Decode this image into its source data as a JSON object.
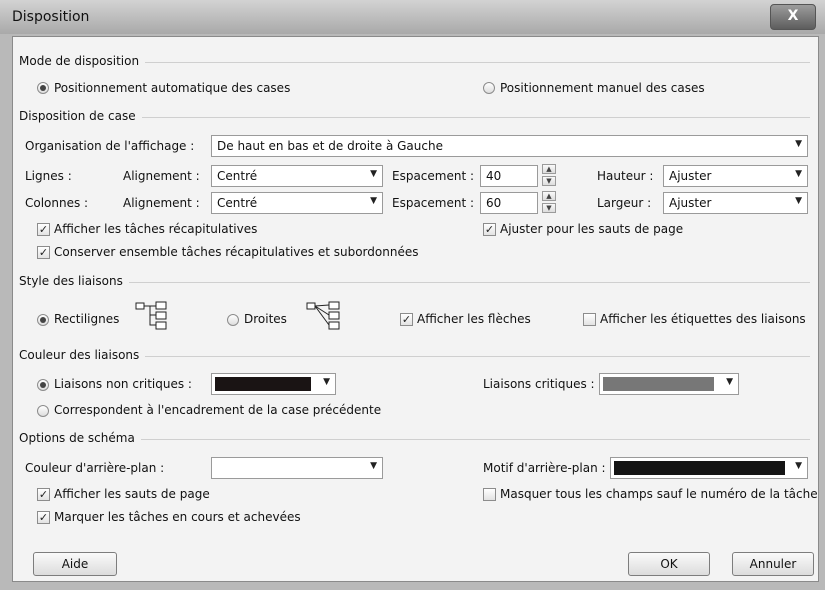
{
  "window": {
    "title": "Disposition",
    "close_label": "X"
  },
  "mode": {
    "section": "Mode de disposition",
    "auto_label": "Positionnement automatique des cases",
    "manual_label": "Positionnement manuel des cases",
    "selected": "auto"
  },
  "box": {
    "section": "Disposition de case",
    "org_label": "Organisation de l'affichage :",
    "org_value": "De haut en bas et de droite à Gauche",
    "rows_label": "Lignes :",
    "cols_label": "Colonnes :",
    "align_label": "Alignement :",
    "row_align": "Centré",
    "col_align": "Centré",
    "spacing_label": "Espacement :",
    "row_spacing": "40",
    "col_spacing": "60",
    "height_label": "Hauteur :",
    "width_label": "Largeur :",
    "height_value": "Ajuster",
    "width_value": "Ajuster",
    "summary_label": "Afficher les tâches récapitulatives",
    "keep_label": "Conserver ensemble tâches récapitulatives et subordonnées",
    "pagebreak_label": "Ajuster pour les sauts de page"
  },
  "links": {
    "section": "Style des liaisons",
    "rect_label": "Rectilignes",
    "straight_label": "Droites",
    "arrows_label": "Afficher les flèches",
    "labels_label": "Afficher les étiquettes des liaisons"
  },
  "colors": {
    "section": "Couleur des liaisons",
    "noncritical_label": "Liaisons non critiques :",
    "critical_label": "Liaisons critiques :",
    "match_label": "Correspondent à l'encadrement de la case précédente",
    "noncritical_color": "#1a1414",
    "critical_color": "#777777"
  },
  "chart": {
    "section": "Options de schéma",
    "bg_color_label": "Couleur d'arrière-plan :",
    "bg_pattern_label": "Motif d'arrière-plan :",
    "pattern_color": "#141414",
    "show_breaks_label": "Afficher les sauts de page",
    "hide_fields_label": "Masquer tous les champs sauf le numéro de la tâche",
    "mark_label": "Marquer les tâches en cours et achevées"
  },
  "buttons": {
    "help": "Aide",
    "ok": "OK",
    "cancel": "Annuler"
  }
}
